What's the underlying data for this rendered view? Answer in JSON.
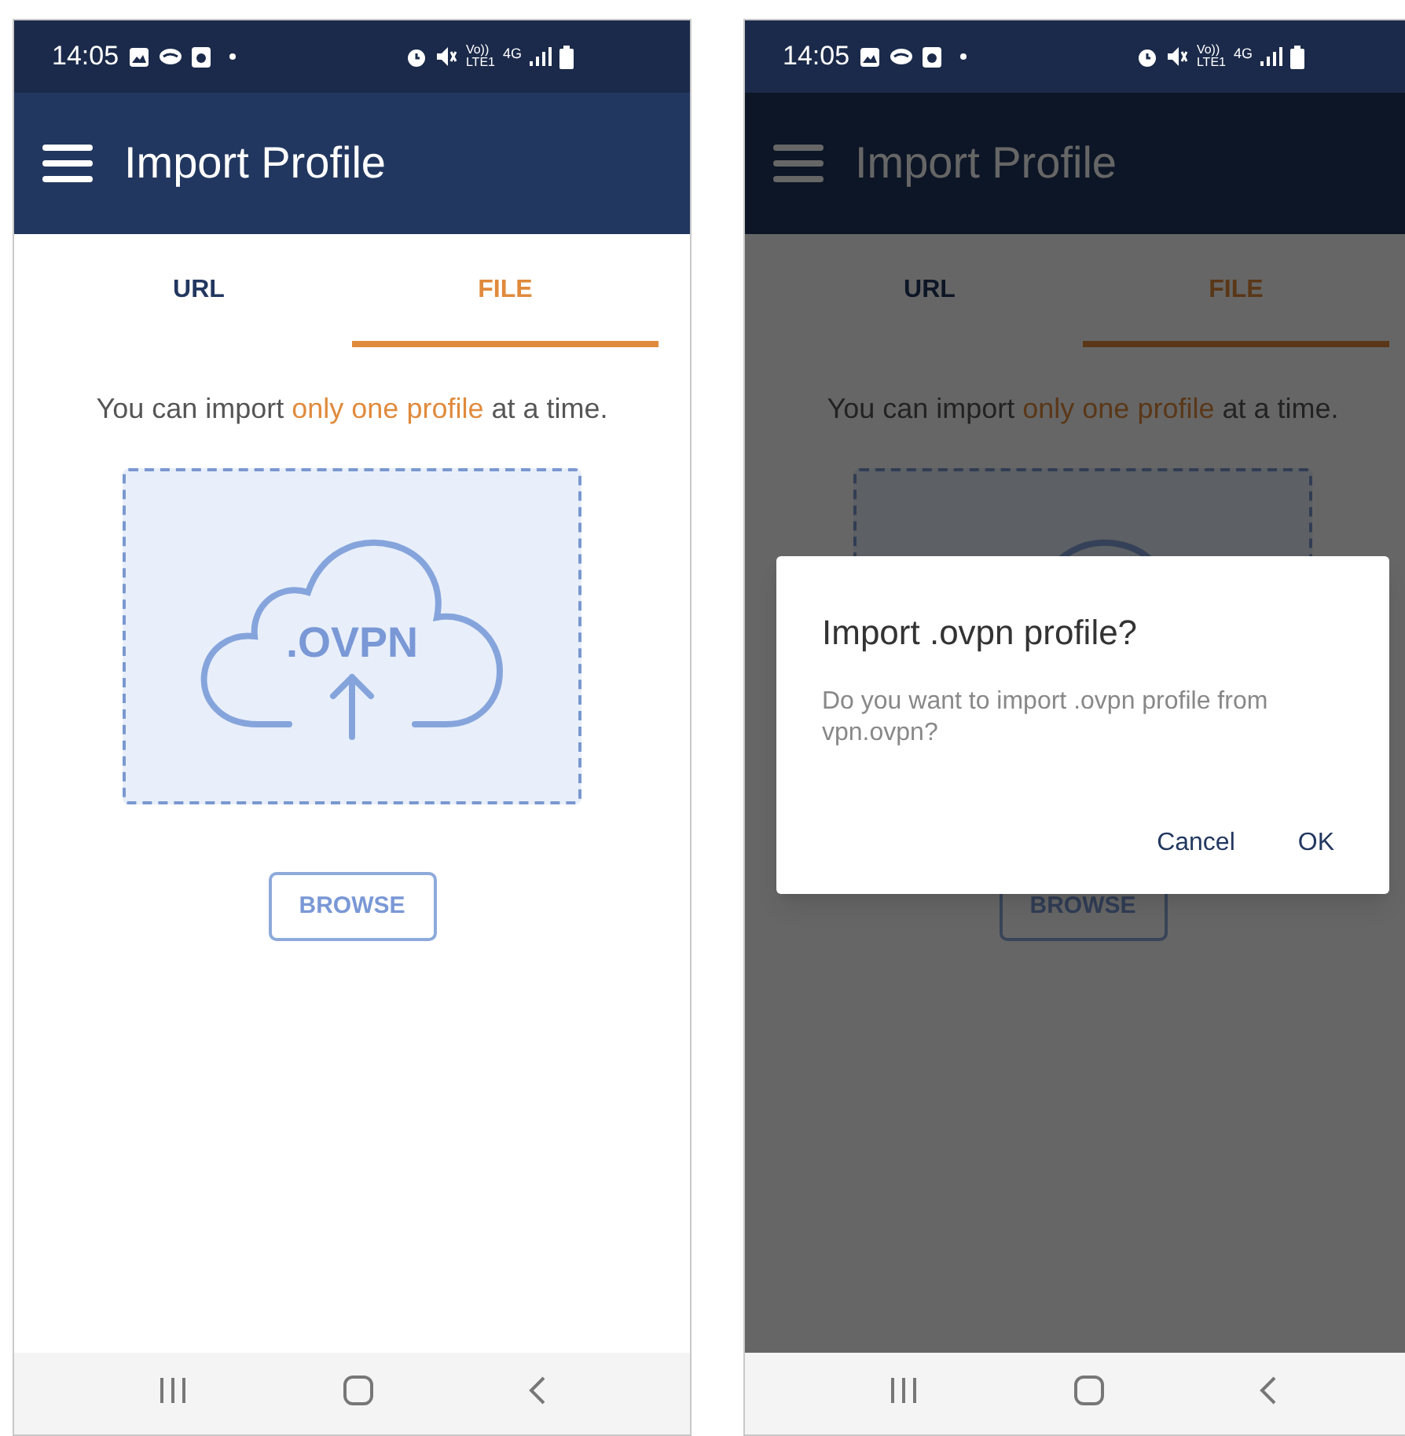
{
  "screens": [
    {
      "status_bar": {
        "time": "14:05",
        "volte": "Vo))",
        "lte": "LTE1",
        "network_type": "4G"
      },
      "app_bar": {
        "title": "Import Profile"
      },
      "tabs": [
        {
          "label": "URL",
          "selected": false
        },
        {
          "label": "FILE",
          "selected": true
        }
      ],
      "notice": {
        "before": "You can import ",
        "highlight": "only one profile",
        "after": " at a time."
      },
      "upload_box": {
        "label": ".OVPN"
      },
      "browse_button": "BROWSE"
    },
    {
      "status_bar": {
        "time": "14:05",
        "volte": "Vo))",
        "lte": "LTE1",
        "network_type": "4G"
      },
      "app_bar": {
        "title": "Import Profile"
      },
      "tabs": [
        {
          "label": "URL",
          "selected": false
        },
        {
          "label": "FILE",
          "selected": true
        }
      ],
      "notice": {
        "before": "You can import ",
        "highlight": "only one profile",
        "after": " at a time."
      },
      "browse_button": "BROWSE",
      "dialog": {
        "title": "Import .ovpn profile?",
        "message": "Do you want to import .ovpn profile from vpn.ovpn?",
        "buttons": [
          "Cancel",
          "OK"
        ]
      }
    }
  ]
}
